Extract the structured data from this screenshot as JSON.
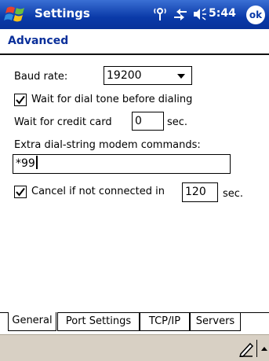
{
  "titlebar": {
    "title": "Settings",
    "time": "5:44",
    "ok_label": "ok",
    "colors": {
      "bar": "#0a3aa8",
      "heading": "#0a2f9a"
    }
  },
  "heading": "Advanced",
  "baud": {
    "label": "Baud rate:",
    "value": "19200"
  },
  "dial_tone": {
    "label": "Wait for dial tone before dialing",
    "checked": true
  },
  "credit_card": {
    "label": "Wait for credit card",
    "value": "0",
    "unit": "sec."
  },
  "extra": {
    "label": "Extra dial-string modem commands:",
    "value": "*99"
  },
  "cancel": {
    "label": "Cancel if not connected in",
    "value": "120",
    "unit": "sec.",
    "checked": true
  },
  "tabs": [
    {
      "label": "General",
      "active": true
    },
    {
      "label": "Port Settings",
      "active": false
    },
    {
      "label": "TCP/IP",
      "active": false
    },
    {
      "label": "Servers",
      "active": false
    }
  ],
  "icons": [
    "windows-start-icon",
    "signal-icon",
    "connectivity-icon",
    "speaker-icon",
    "pen-icon",
    "chevron-up-icon"
  ]
}
